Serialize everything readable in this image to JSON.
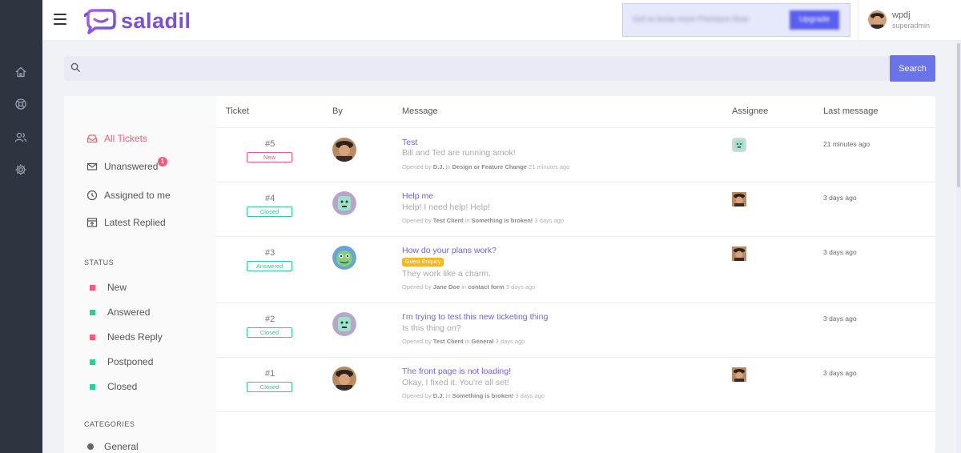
{
  "brand": {
    "name": "saladil"
  },
  "user": {
    "name": "wpdj",
    "role": "superadmin"
  },
  "promo": {
    "text": "Get to know more Premium Now",
    "button": "Upgrade"
  },
  "search": {
    "placeholder": "",
    "button_label": "Search"
  },
  "sidebar": {
    "items": [
      {
        "label": "All Tickets",
        "icon": "inbox-icon",
        "active": true
      },
      {
        "label": "Unanswered",
        "icon": "envelope-icon",
        "badge": "1"
      },
      {
        "label": "Assigned to me",
        "icon": "clock-icon"
      },
      {
        "label": "Latest Replied",
        "icon": "reply-icon"
      }
    ],
    "status_heading": "STATUS",
    "statuses": [
      {
        "label": "New",
        "color": "#ef5d7a"
      },
      {
        "label": "Answered",
        "color": "#2ecc9a"
      },
      {
        "label": "Needs Reply",
        "color": "#ef5d7a"
      },
      {
        "label": "Postponed",
        "color": "#2ecc9a"
      },
      {
        "label": "Closed",
        "color": "#2ecc9a"
      }
    ],
    "categories_heading": "CATEGORIES",
    "categories": [
      {
        "label": "General"
      }
    ]
  },
  "table": {
    "headers": {
      "ticket": "Ticket",
      "by": "By",
      "message": "Message",
      "assignee": "Assignee",
      "last": "Last message"
    },
    "rows": [
      {
        "num": "#5",
        "status": "New",
        "status_color": "#ef5d7a",
        "by_avatar": "man-avatar",
        "title": "Test",
        "tag": "",
        "body": "Bill and Ted are running amok!",
        "meta_opened": "Opened by",
        "meta_by": "D.J.",
        "meta_in": "in",
        "meta_cat": "Design or Feature Change",
        "meta_time": "21 minutes ago",
        "assignee_avatar": "robot-avatar",
        "last": "21 minutes ago"
      },
      {
        "num": "#4",
        "status": "Closed",
        "status_color": "#2ecc9a",
        "by_avatar": "robot-avatar",
        "title": "Help me",
        "tag": "",
        "body": "Help! I need help! Help!",
        "meta_opened": "Opened by",
        "meta_by": "Test Client",
        "meta_in": "in",
        "meta_cat": "Something is broken!",
        "meta_time": "3 days ago",
        "assignee_avatar": "man-avatar",
        "last": "3 days ago"
      },
      {
        "num": "#3",
        "status": "Answered",
        "status_color": "#2ecc9a",
        "by_avatar": "monster-avatar",
        "title": "How do your plans work?",
        "tag": "Guest Enquiry",
        "body": "They work like a charm.",
        "meta_opened": "Opened by",
        "meta_by": "Jane Doe",
        "meta_in": "in",
        "meta_cat": "contact form",
        "meta_time": "3 days ago",
        "assignee_avatar": "man-avatar",
        "last": "3 days ago"
      },
      {
        "num": "#2",
        "status": "Closed",
        "status_color": "#2ecc9a",
        "by_avatar": "robot-avatar",
        "title": "I'm trying to test this new ticketing thing",
        "tag": "",
        "body": "Is this thing on?",
        "meta_opened": "Opened by",
        "meta_by": "Test Client",
        "meta_in": "in",
        "meta_cat": "General",
        "meta_time": "3 days ago",
        "assignee_avatar": "",
        "last": "3 days ago"
      },
      {
        "num": "#1",
        "status": "Closed",
        "status_color": "#2ecc9a",
        "by_avatar": "man-avatar",
        "title": "The front page is not loading!",
        "tag": "",
        "body": "Okay, I fixed it. You're all set!",
        "meta_opened": "Opened by",
        "meta_by": "D.J.",
        "meta_in": "in",
        "meta_cat": "Something is broken!",
        "meta_time": "3 days ago",
        "assignee_avatar": "man-avatar",
        "last": "3 days ago"
      }
    ]
  },
  "colors": {
    "accent": "#6b73e8",
    "brand": "#7a4fd9",
    "rail": "#2f3441",
    "link": "#6f66d6"
  }
}
